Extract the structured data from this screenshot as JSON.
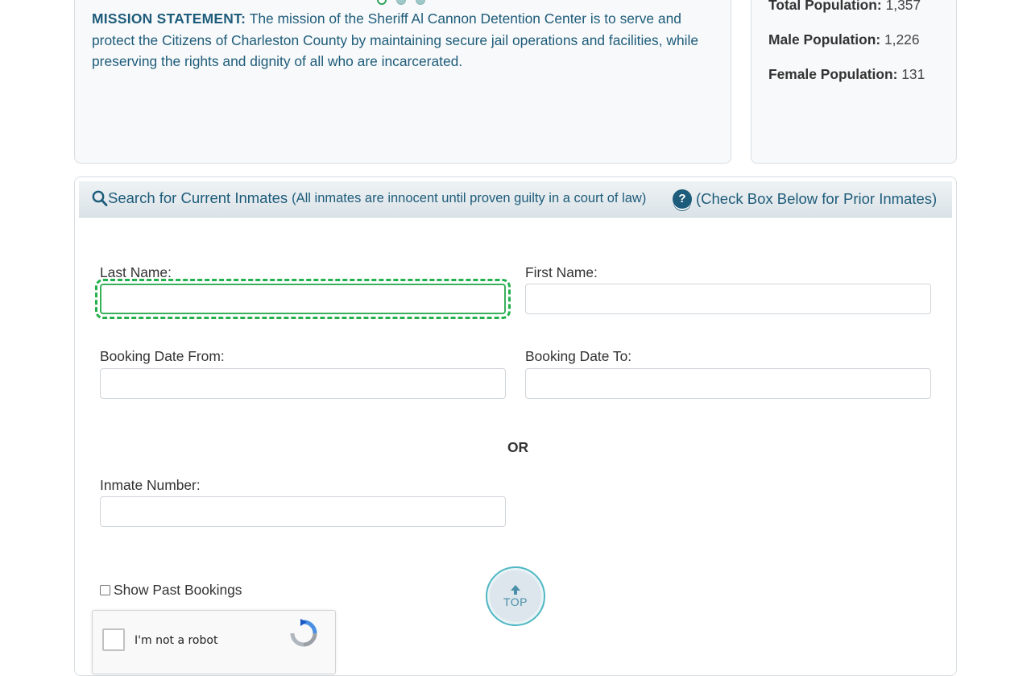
{
  "mission": {
    "label": "MISSION STATEMENT:",
    "text": "The mission of the Sheriff Al Cannon Detention Center is to serve and protect the Citizens of Charleston County by maintaining secure jail operations and facilities, while preserving the rights and dignity of all who are incarcerated."
  },
  "carousel": {
    "dot_count": 3,
    "active_index": 0
  },
  "stats": {
    "total": {
      "label": "Total Population:",
      "value": "1,357"
    },
    "male": {
      "label": "Male Population:",
      "value": "1,226"
    },
    "female": {
      "label": "Female Population:",
      "value": "131"
    }
  },
  "search": {
    "title": "Search for Current Inmates",
    "subtitle": "(All inmates are innocent until proven guilty in a court of law)",
    "help_text": "(Check Box Below for Prior Inmates)",
    "help_icon": "?",
    "or_text": "OR",
    "fields": {
      "last_name": {
        "label": "Last Name:",
        "value": ""
      },
      "first_name": {
        "label": "First Name:",
        "value": ""
      },
      "booking_from": {
        "label": "Booking Date From:",
        "value": ""
      },
      "booking_to": {
        "label": "Booking Date To:",
        "value": ""
      },
      "inmate_number": {
        "label": "Inmate Number:",
        "value": ""
      }
    },
    "past_bookings_label": "Show Past Bookings",
    "past_bookings_checked": false
  },
  "recaptcha": {
    "label": "I'm not a robot",
    "icon": "recaptcha-logo-icon"
  },
  "top_button": {
    "label": "TOP",
    "icon": "arrow-up-icon"
  },
  "colors": {
    "accent": "#1d5c7a",
    "focus": "#22b14c",
    "top_ring": "#4fb8c4"
  }
}
